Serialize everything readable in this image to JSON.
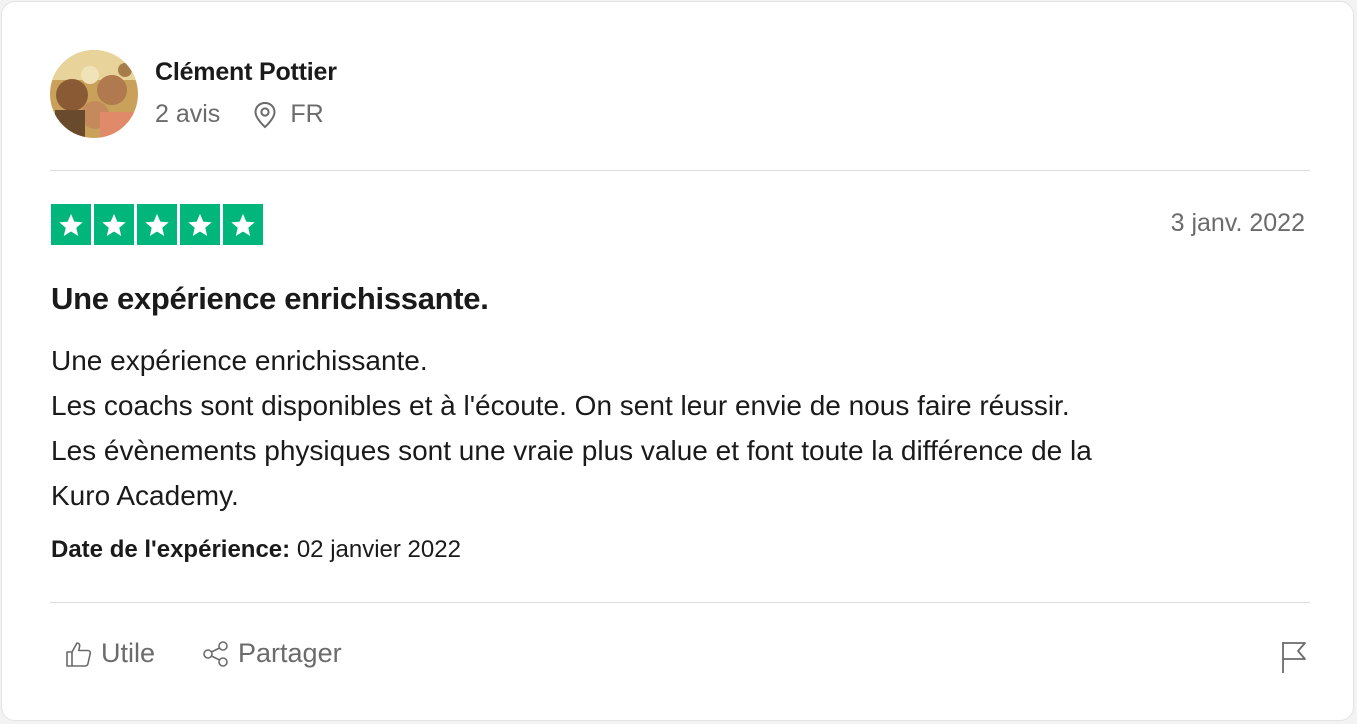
{
  "reviewer": {
    "name": "Clément Pottier",
    "review_count": "2 avis",
    "country": "FR"
  },
  "review": {
    "rating": 5,
    "date": "3 janv. 2022",
    "title": "Une expérience enrichissante.",
    "body_lines": [
      "Une expérience enrichissante.",
      "Les coachs sont disponibles et à l'écoute. On sent leur envie de nous faire réussir.",
      "Les évènements physiques sont une vraie plus value et font toute la différence de la",
      "Kuro Academy."
    ],
    "experience_date_label": "Date de l'expérience:",
    "experience_date_value": "02 janvier 2022"
  },
  "actions": {
    "useful_label": "Utile",
    "share_label": "Partager"
  },
  "icons": {
    "location": "location-pin-icon",
    "star": "star-icon",
    "useful": "thumbs-up-icon",
    "share": "share-icon",
    "report": "flag-icon"
  },
  "colors": {
    "star_green": "#00b67a",
    "text_primary": "#1a1a1a",
    "text_secondary": "#6b6b6b"
  }
}
